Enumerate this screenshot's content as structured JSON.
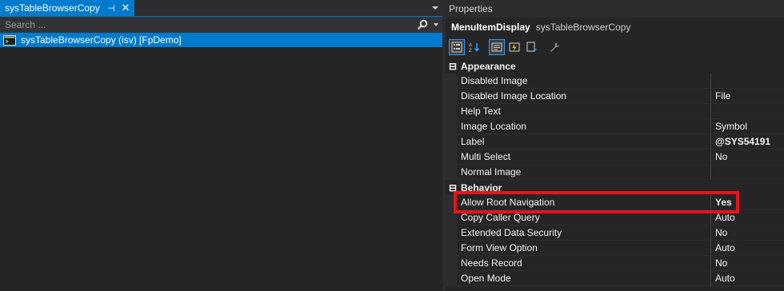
{
  "document_tab": {
    "title": "sysTableBrowserCopy",
    "pin_glyph": "⊣",
    "close_glyph": "✕"
  },
  "search": {
    "placeholder": "Search ..."
  },
  "tree": {
    "items": [
      {
        "label": "sysTableBrowserCopy (isv) [FpDemo]",
        "selected": true,
        "icon": "menu-item-display-icon"
      }
    ]
  },
  "properties": {
    "panel_title": "Properties",
    "object_type": "MenuItemDisplay",
    "object_name": "sysTableBrowserCopy",
    "toolbar": [
      {
        "name": "categorized-view-button",
        "icon": "categorized-icon",
        "active": true
      },
      {
        "name": "alphabetical-view-button",
        "icon": "sort-az-icon",
        "active": false
      },
      {
        "name": "properties-button",
        "icon": "properties-icon",
        "active": true
      },
      {
        "name": "events-button",
        "icon": "events-icon",
        "active": false
      },
      {
        "name": "property-pages-button",
        "icon": "property-pages-icon",
        "active": false
      },
      {
        "name": "settings-button",
        "icon": "wrench-icon",
        "active": false
      }
    ],
    "categories": [
      {
        "label": "Appearance",
        "expand_glyph": "⊟",
        "rows": [
          {
            "name": "Disabled Image",
            "value": ""
          },
          {
            "name": "Disabled Image Location",
            "value": "File"
          },
          {
            "name": "Help Text",
            "value": ""
          },
          {
            "name": "Image Location",
            "value": "Symbol"
          },
          {
            "name": "Label",
            "value": "@SYS54191",
            "bold": true
          },
          {
            "name": "Multi Select",
            "value": "No"
          },
          {
            "name": "Normal Image",
            "value": ""
          }
        ]
      },
      {
        "label": "Behavior",
        "expand_glyph": "⊟",
        "rows": [
          {
            "name": "Allow Root Navigation",
            "value": "Yes",
            "bold": true,
            "highlighted": true
          },
          {
            "name": "Copy Caller Query",
            "value": "Auto"
          },
          {
            "name": "Extended Data Security",
            "value": "No"
          },
          {
            "name": "Form View Option",
            "value": "Auto"
          },
          {
            "name": "Needs Record",
            "value": "No"
          },
          {
            "name": "Open Mode",
            "value": "Auto"
          }
        ]
      }
    ]
  },
  "colors": {
    "accent": "#007acc",
    "highlight_border": "#e5141c",
    "panel_bg": "#252526",
    "header_bg": "#2d2d30"
  }
}
